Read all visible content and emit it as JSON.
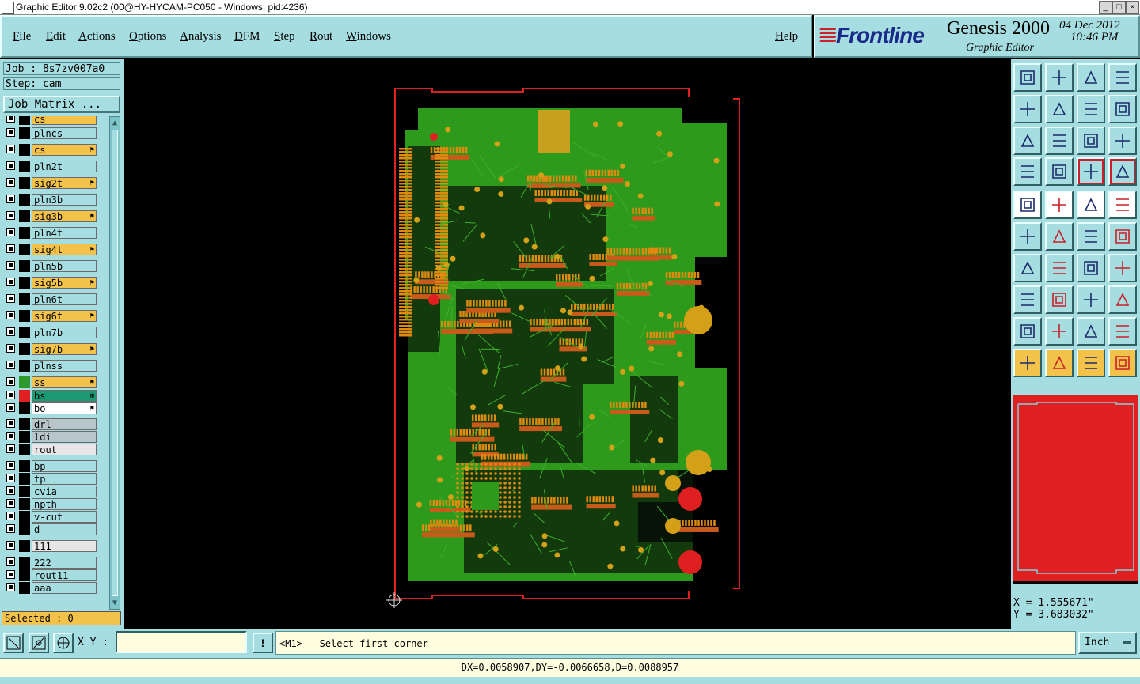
{
  "window": {
    "title": "Graphic Editor 9.02c2 (00@HY-HYCAM-PC050 - Windows, pid:4236)",
    "controls": [
      "_",
      "□",
      "×"
    ]
  },
  "menu": {
    "items": [
      "File",
      "Edit",
      "Actions",
      "Options",
      "Analysis",
      "DFM",
      "Step",
      "Rout",
      "Windows"
    ],
    "help": "Help"
  },
  "brand": {
    "logo": "Frontline",
    "product": "Genesis 2000",
    "module": "Graphic Editor",
    "date": "04 Dec 2012",
    "time": "10:46 PM"
  },
  "job": {
    "job_label": "Job : 8s7zv007a0",
    "step_label": "Step: cam",
    "matrix_button": "Job Matrix ..."
  },
  "layers": [
    {
      "name": "cs",
      "color": "#f2c24a"
    },
    {
      "name": "plncs",
      "color": "#a6dde0"
    },
    {
      "name": "cs",
      "color": "#f2c24a",
      "mark": "⚑"
    },
    {
      "name": "pln2t",
      "color": "#a6dde0"
    },
    {
      "name": "sig2t",
      "color": "#f2c24a",
      "mark": "⚑"
    },
    {
      "name": "pln3b",
      "color": "#a6dde0"
    },
    {
      "name": "sig3b",
      "color": "#f2c24a",
      "mark": "⚑"
    },
    {
      "name": "pln4t",
      "color": "#a6dde0"
    },
    {
      "name": "sig4t",
      "color": "#f2c24a",
      "mark": "⚑"
    },
    {
      "name": "pln5b",
      "color": "#a6dde0"
    },
    {
      "name": "sig5b",
      "color": "#f2c24a",
      "mark": "⚑"
    },
    {
      "name": "pln6t",
      "color": "#a6dde0"
    },
    {
      "name": "sig6t",
      "color": "#f2c24a",
      "mark": "⚑"
    },
    {
      "name": "pln7b",
      "color": "#a6dde0"
    },
    {
      "name": "sig7b",
      "color": "#f2c24a",
      "mark": "⚑"
    },
    {
      "name": "plnss",
      "color": "#a6dde0"
    },
    {
      "name": "ss",
      "color": "#f2c24a",
      "mark": "⚑",
      "swatch": "#2e9a2e"
    },
    {
      "name": "bs",
      "color": "#1c9a74",
      "mark": "⊞",
      "swatch": "#e02020",
      "active": true
    },
    {
      "name": "bo",
      "color": "#ffffff",
      "mark": "⚑"
    },
    {
      "name": "drl",
      "color": "#b8c6cc"
    },
    {
      "name": "ldi",
      "color": "#b8c6cc"
    },
    {
      "name": "rout",
      "color": "#e6e6e6"
    },
    {
      "name": "bp",
      "color": "#a6dde0"
    },
    {
      "name": "tp",
      "color": "#a6dde0"
    },
    {
      "name": "cvia",
      "color": "#a6dde0"
    },
    {
      "name": "npth",
      "color": "#a6dde0"
    },
    {
      "name": "v-cut",
      "color": "#a6dde0"
    },
    {
      "name": "d",
      "color": "#a6dde0"
    },
    {
      "name": "111",
      "color": "#e6e6e6"
    },
    {
      "name": "222",
      "color": "#a6dde0"
    },
    {
      "name": "rout11",
      "color": "#a6dde0"
    },
    {
      "name": "aaa",
      "color": "#a6dde0"
    }
  ],
  "selected": "Selected : 0",
  "coords": {
    "x": "X = 1.555671\"",
    "y": "Y = 3.683032\""
  },
  "bottom": {
    "xy_label": "X Y :",
    "xy_value": "",
    "prompt": "<M1> - Select first corner",
    "units": "Inch",
    "measure": "DX=0.0058907,DY=-0.0066658,D=0.0088957"
  },
  "colors": {
    "board_green": "#2e9a1c",
    "pad_orange": "#e08a10",
    "outline_red": "#e02020",
    "panel": "#a6dde0"
  }
}
